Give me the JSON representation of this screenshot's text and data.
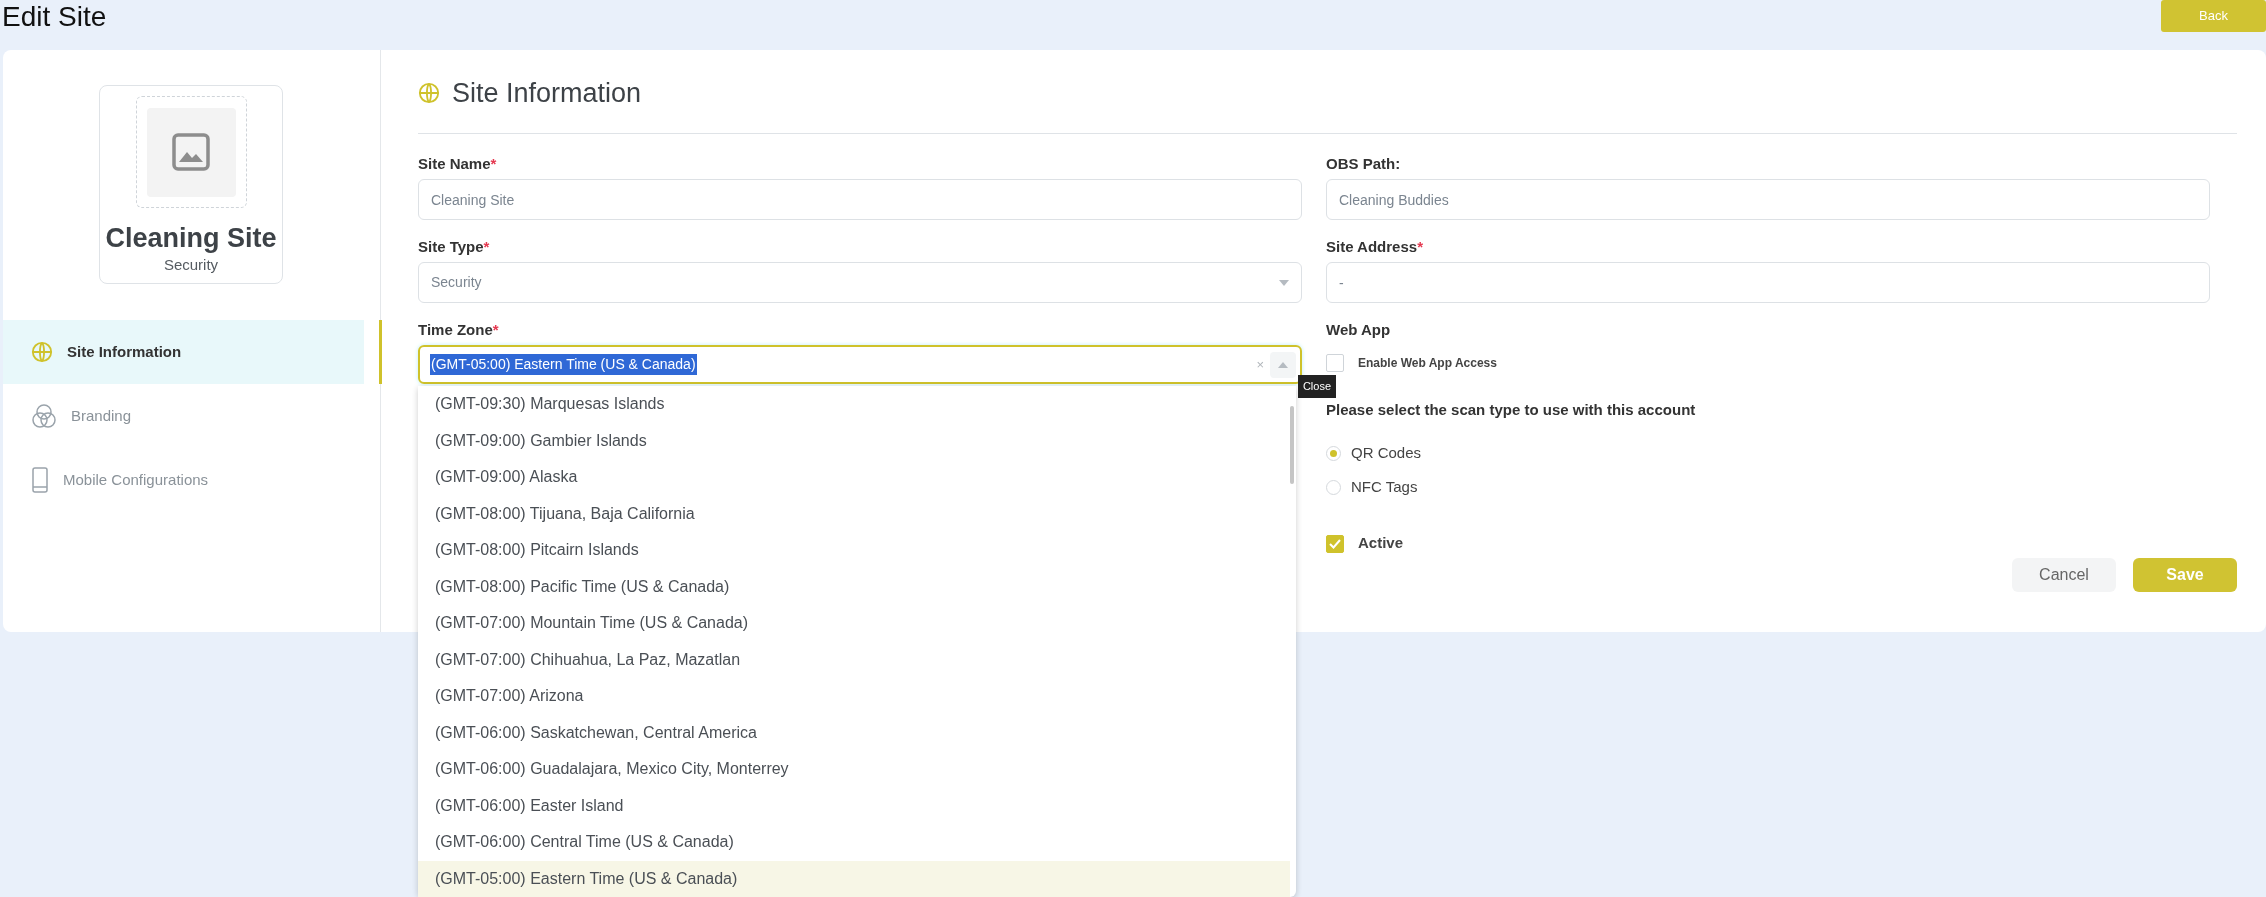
{
  "page": {
    "title": "Edit Site",
    "back_button": "Back"
  },
  "sidebar": {
    "site_card": {
      "name": "Cleaning Site",
      "type": "Security"
    },
    "items": [
      {
        "label": "Site Information",
        "kind": "globe",
        "selected": true
      },
      {
        "label": "Branding",
        "kind": "circles",
        "selected": false
      },
      {
        "label": "Mobile Configurations",
        "kind": "phone",
        "selected": false
      }
    ]
  },
  "section": {
    "title": "Site Information"
  },
  "left_fields": [
    {
      "label": "Site Name",
      "required_mark": "*",
      "kind": "text",
      "value": "Cleaning Site"
    },
    {
      "label": "Site Type",
      "required_mark": "*",
      "kind": "select",
      "value": "Security"
    }
  ],
  "time_zone": {
    "label": "Time Zone",
    "required_mark": "*",
    "value": "(GMT-05:00) Eastern Time (US & Canada)",
    "clear": "×",
    "tooltip": "Close",
    "expanded": true,
    "options": [
      {
        "label": "(GMT-09:30) Marquesas Islands",
        "selected": false
      },
      {
        "label": "(GMT-09:00) Gambier Islands",
        "selected": false
      },
      {
        "label": "(GMT-09:00) Alaska",
        "selected": false
      },
      {
        "label": "(GMT-08:00) Tijuana, Baja California",
        "selected": false
      },
      {
        "label": "(GMT-08:00) Pitcairn Islands",
        "selected": false
      },
      {
        "label": "(GMT-08:00) Pacific Time (US & Canada)",
        "selected": false
      },
      {
        "label": "(GMT-07:00) Mountain Time (US & Canada)",
        "selected": false
      },
      {
        "label": "(GMT-07:00) Chihuahua, La Paz, Mazatlan",
        "selected": false
      },
      {
        "label": "(GMT-07:00) Arizona",
        "selected": false
      },
      {
        "label": "(GMT-06:00) Saskatchewan, Central America",
        "selected": false
      },
      {
        "label": "(GMT-06:00) Guadalajara, Mexico City, Monterrey",
        "selected": false
      },
      {
        "label": "(GMT-06:00) Easter Island",
        "selected": false
      },
      {
        "label": "(GMT-06:00) Central Time (US & Canada)",
        "selected": false
      },
      {
        "label": "(GMT-05:00) Eastern Time (US & Canada)",
        "selected": true
      }
    ]
  },
  "right_fields": [
    {
      "label": "OBS Path:",
      "value": "Cleaning Buddies"
    },
    {
      "label": "Site Address",
      "required_mark": "*",
      "value": "-"
    }
  ],
  "web_app": {
    "label": "Web App",
    "option": {
      "label": "Enable Web App Access",
      "checked": false
    }
  },
  "scan_type": {
    "prompt": "Please select the scan type to use with this account",
    "options": [
      {
        "label": "QR Codes",
        "selected": true
      },
      {
        "label": "NFC Tags",
        "selected": false
      }
    ]
  },
  "active": {
    "label": "Active",
    "checked": true
  },
  "buttons": [
    {
      "label": "Cancel",
      "kind": "secondary"
    },
    {
      "label": "Save",
      "kind": "primary"
    }
  ]
}
